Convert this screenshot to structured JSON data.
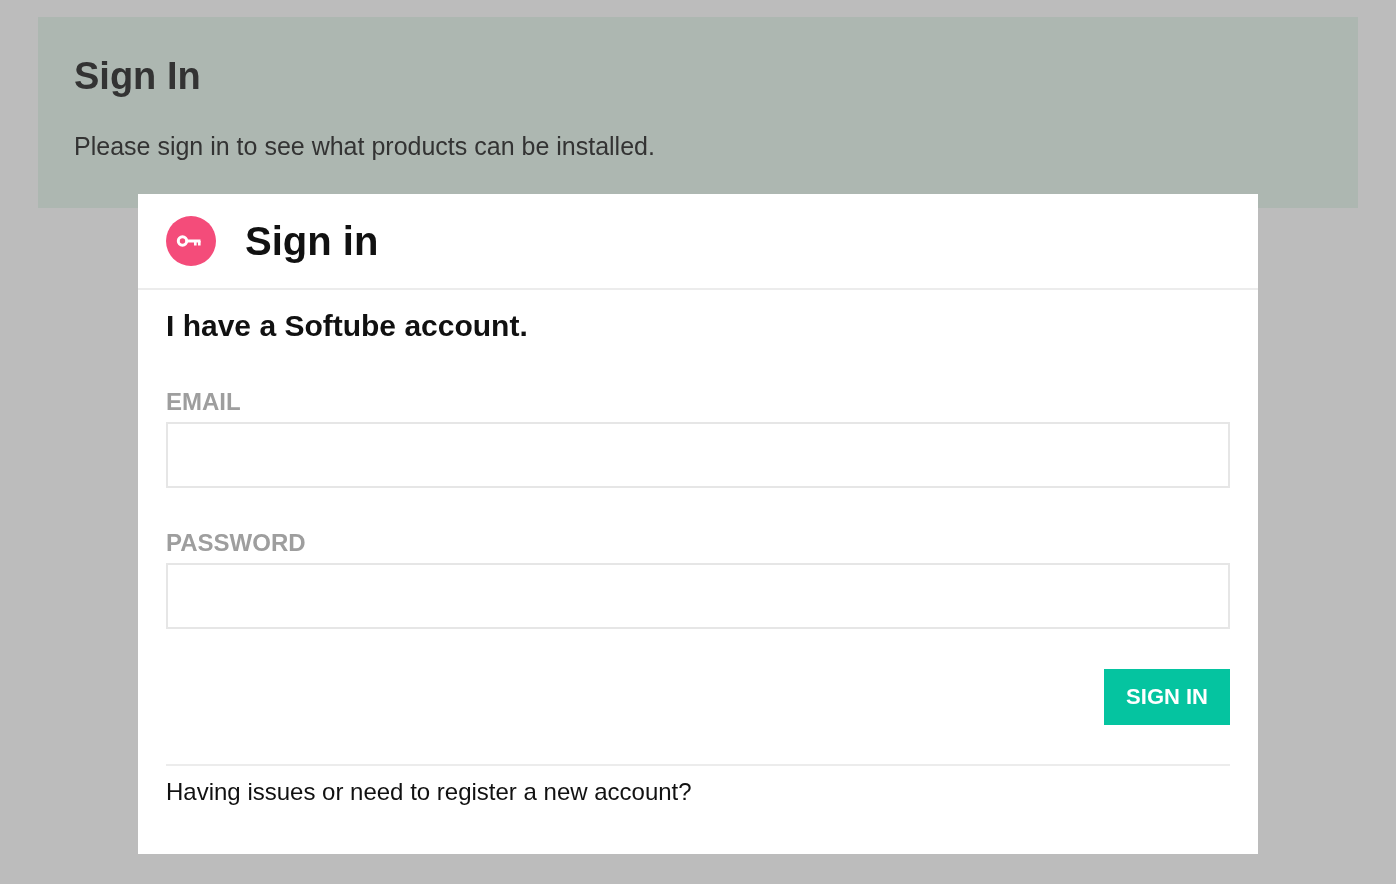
{
  "banner": {
    "title": "Sign In",
    "message": "Please sign in to see what products can be installed."
  },
  "dialog": {
    "title": "Sign in",
    "heading": "I have a Softube account.",
    "fields": [
      {
        "label": "EMAIL"
      },
      {
        "label": "PASSWORD"
      }
    ],
    "button": "SIGN IN",
    "footer": "Having issues or need to register a new account?"
  }
}
